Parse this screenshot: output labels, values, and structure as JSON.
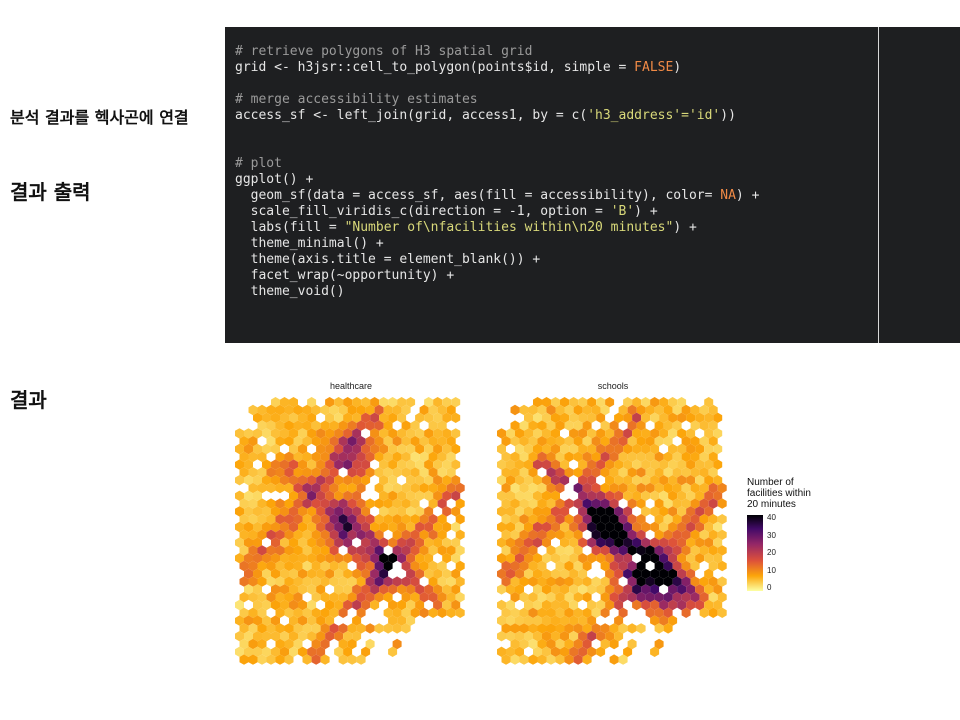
{
  "labels": {
    "connect": "분석 결과를 헥사곤에 연결",
    "output": "결과 출력",
    "result": "결과"
  },
  "code": {
    "lines": [
      [
        {
          "t": "# retrieve polygons of H3 spatial grid",
          "c": "com"
        }
      ],
      [
        {
          "t": "grid <- h3jsr::cell_to_polygon(points$id, simple = ",
          "c": "txt"
        },
        {
          "t": "FALSE",
          "c": "num"
        },
        {
          "t": ")",
          "c": "txt"
        }
      ],
      [
        {
          "t": "",
          "c": "txt"
        }
      ],
      [
        {
          "t": "# merge accessibility estimates",
          "c": "com"
        }
      ],
      [
        {
          "t": "access_sf <- left_join(grid, access1, by = c(",
          "c": "txt"
        },
        {
          "t": "'h3_address'='id'",
          "c": "str"
        },
        {
          "t": "))",
          "c": "txt"
        }
      ],
      [
        {
          "t": "",
          "c": "txt"
        }
      ],
      [
        {
          "t": "",
          "c": "txt"
        }
      ],
      [
        {
          "t": "# plot",
          "c": "com"
        }
      ],
      [
        {
          "t": "ggplot() +",
          "c": "txt"
        }
      ],
      [
        {
          "t": "  geom_sf(data = access_sf, aes(fill = accessibility), color= ",
          "c": "txt"
        },
        {
          "t": "NA",
          "c": "num"
        },
        {
          "t": ") +",
          "c": "txt"
        }
      ],
      [
        {
          "t": "  scale_fill_viridis_c(direction = -1, option = ",
          "c": "txt"
        },
        {
          "t": "'B'",
          "c": "str"
        },
        {
          "t": ") +",
          "c": "txt"
        }
      ],
      [
        {
          "t": "  labs(fill = ",
          "c": "txt"
        },
        {
          "t": "\"Number of\\nfacilities within\\n20 minutes\"",
          "c": "str"
        },
        {
          "t": ") +",
          "c": "txt"
        }
      ],
      [
        {
          "t": "  theme_minimal() +",
          "c": "txt"
        }
      ],
      [
        {
          "t": "  theme(axis.title = element_blank()) +",
          "c": "txt"
        }
      ],
      [
        {
          "t": "  facet_wrap(~opportunity) +",
          "c": "txt"
        }
      ],
      [
        {
          "t": "  theme_void()",
          "c": "txt"
        }
      ]
    ]
  },
  "chart_data": {
    "type": "heatmap",
    "facets": [
      "healthcare",
      "schools"
    ],
    "legend": {
      "title": "Number of\nfacilities within\n20 minutes",
      "ticks": [
        40,
        30,
        20,
        10,
        0
      ],
      "palette": "inferno (reversed)"
    },
    "hotspots": {
      "healthcare": [
        {
          "dx": -0.05,
          "dy": -0.05,
          "value": 20
        },
        {
          "dx": 0.3,
          "dy": 0.25,
          "value": 18
        },
        {
          "dx": 0.0,
          "dy": -0.55,
          "value": 14
        }
      ],
      "schools": [
        {
          "dx": -0.05,
          "dy": -0.05,
          "value": 40
        },
        {
          "dx": 0.25,
          "dy": 0.28,
          "value": 28
        },
        {
          "dx": 0.45,
          "dy": 0.4,
          "value": 22
        }
      ]
    }
  }
}
